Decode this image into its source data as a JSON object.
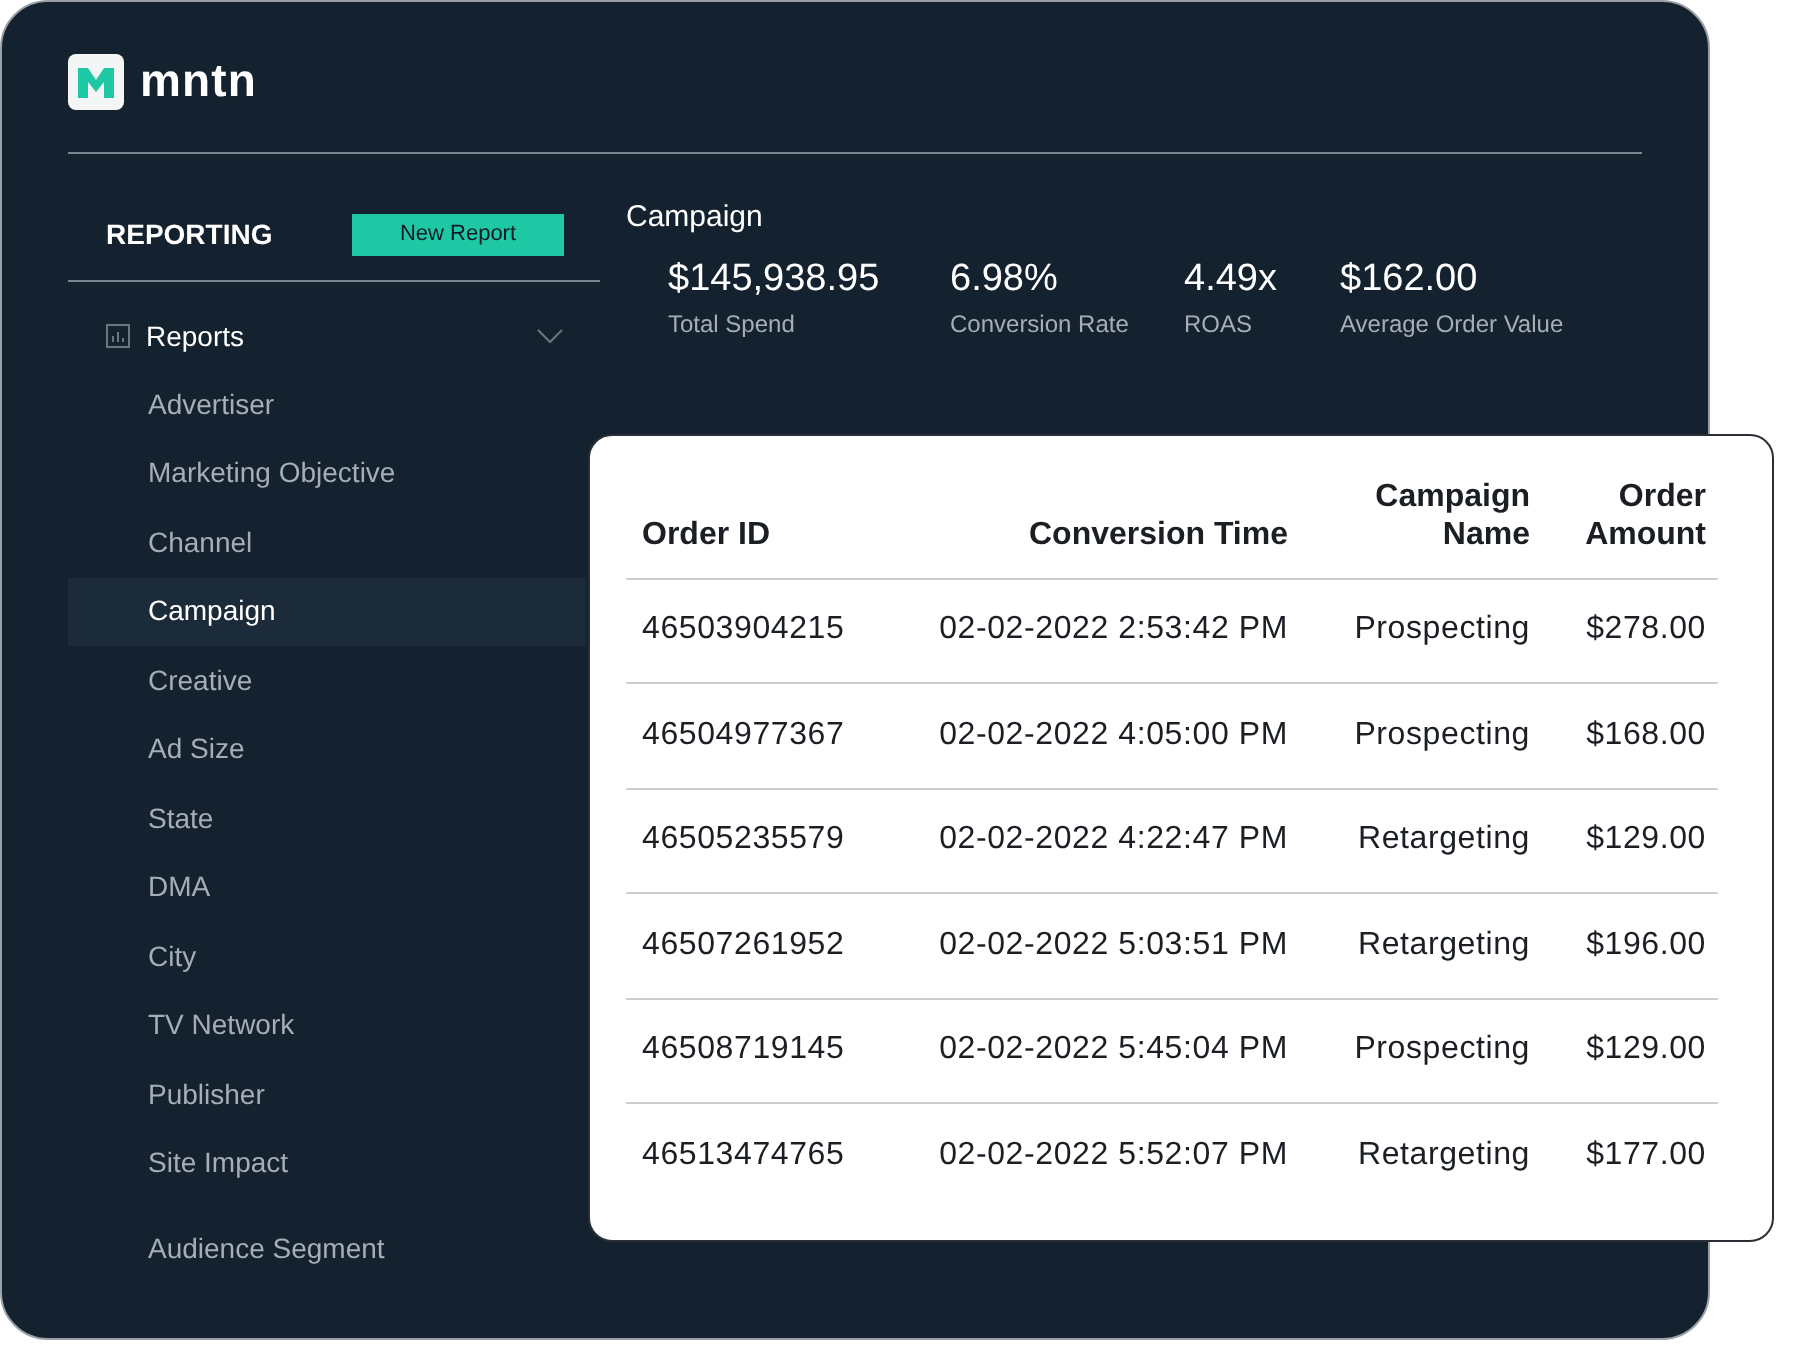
{
  "logo": {
    "text": "mntn"
  },
  "sidebar": {
    "title": "REPORTING",
    "button": "New Report",
    "group": {
      "label": "Reports",
      "expanded": true,
      "items": [
        {
          "label": "Advertiser",
          "selected": false
        },
        {
          "label": "Marketing Objective",
          "selected": false
        },
        {
          "label": "Channel",
          "selected": false
        },
        {
          "label": "Campaign",
          "selected": true
        },
        {
          "label": "Creative",
          "selected": false
        },
        {
          "label": "Ad Size",
          "selected": false
        },
        {
          "label": "State",
          "selected": false
        },
        {
          "label": "DMA",
          "selected": false
        },
        {
          "label": "City",
          "selected": false
        },
        {
          "label": "TV Network",
          "selected": false
        },
        {
          "label": "Publisher",
          "selected": false
        },
        {
          "label": "Site Impact",
          "selected": false
        },
        {
          "label": "Audience Segment",
          "selected": false
        }
      ]
    }
  },
  "main": {
    "title": "Campaign",
    "metrics": [
      {
        "value": "$145,938.95",
        "label": "Total Spend"
      },
      {
        "value": "6.98%",
        "label": "Conversion Rate"
      },
      {
        "value": "4.49x",
        "label": "ROAS"
      },
      {
        "value": "$162.00",
        "label": "Average Order Value"
      }
    ]
  },
  "table": {
    "columns": [
      "Order ID",
      "Conversion Time",
      "Campaign Name",
      "Order Amount"
    ],
    "rows": [
      [
        "46503904215",
        "02-02-2022 2:53:42 PM",
        "Prospecting",
        "$278.00"
      ],
      [
        "46504977367",
        "02-02-2022 4:05:00 PM",
        "Prospecting",
        "$168.00"
      ],
      [
        "46505235579",
        "02-02-2022 4:22:47 PM",
        "Retargeting",
        "$129.00"
      ],
      [
        "46507261952",
        "02-02-2022 5:03:51 PM",
        "Retargeting",
        "$196.00"
      ],
      [
        "46508719145",
        "02-02-2022 5:45:04 PM",
        "Prospecting",
        "$129.00"
      ],
      [
        "46513474765",
        "02-02-2022 5:52:07 PM",
        "Retargeting",
        "$177.00"
      ]
    ]
  }
}
